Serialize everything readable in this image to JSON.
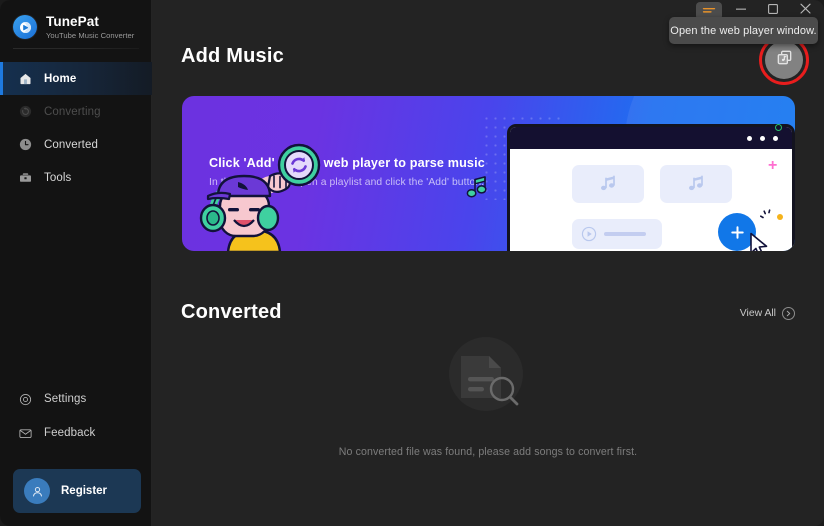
{
  "brand": {
    "title": "TunePat",
    "subtitle": "YouTube Music Converter",
    "logo_icon": "tunepat-logo-icon"
  },
  "sidebar": {
    "items": [
      {
        "label": "Home",
        "icon": "home-icon",
        "state": "active"
      },
      {
        "label": "Converting",
        "icon": "refresh-icon",
        "state": "disabled"
      },
      {
        "label": "Converted",
        "icon": "clock-icon",
        "state": "normal"
      },
      {
        "label": "Tools",
        "icon": "toolbox-icon",
        "state": "normal"
      }
    ],
    "bottom_items": [
      {
        "label": "Settings",
        "icon": "gear-icon"
      },
      {
        "label": "Feedback",
        "icon": "envelope-icon"
      }
    ],
    "register": {
      "label": "Register",
      "icon": "user-avatar-icon"
    }
  },
  "titlebar": {
    "menu_icon": "hamburger-menu-icon",
    "minimize_icon": "minimize-icon",
    "maximize_icon": "maximize-icon",
    "close_icon": "close-icon"
  },
  "tooltip": {
    "text": "Open the web player window."
  },
  "main": {
    "add_music_title": "Add Music",
    "webplayer_button_icon": "web-player-window-icon",
    "banner": {
      "heading": "Click 'Add' icon in web player to parse music",
      "subtext": "In the web player, open a playlist and click the 'Add' button."
    },
    "converted_title": "Converted",
    "view_all": {
      "label": "View All",
      "icon": "chevron-right-circle-icon"
    },
    "empty_state": {
      "icon": "no-file-found-icon",
      "message": "No converted file was found, please add songs to convert first."
    }
  },
  "colors": {
    "sidebar_bg": "#131313",
    "main_bg": "#232323",
    "accent_blue": "#1e7ae0",
    "register_bg": "#1c3854",
    "highlight_ring": "#e81d1d",
    "tooltip_bg": "#4b4b4b",
    "banner_gradient_start": "#6c32e0",
    "banner_gradient_end": "#1478f0"
  }
}
